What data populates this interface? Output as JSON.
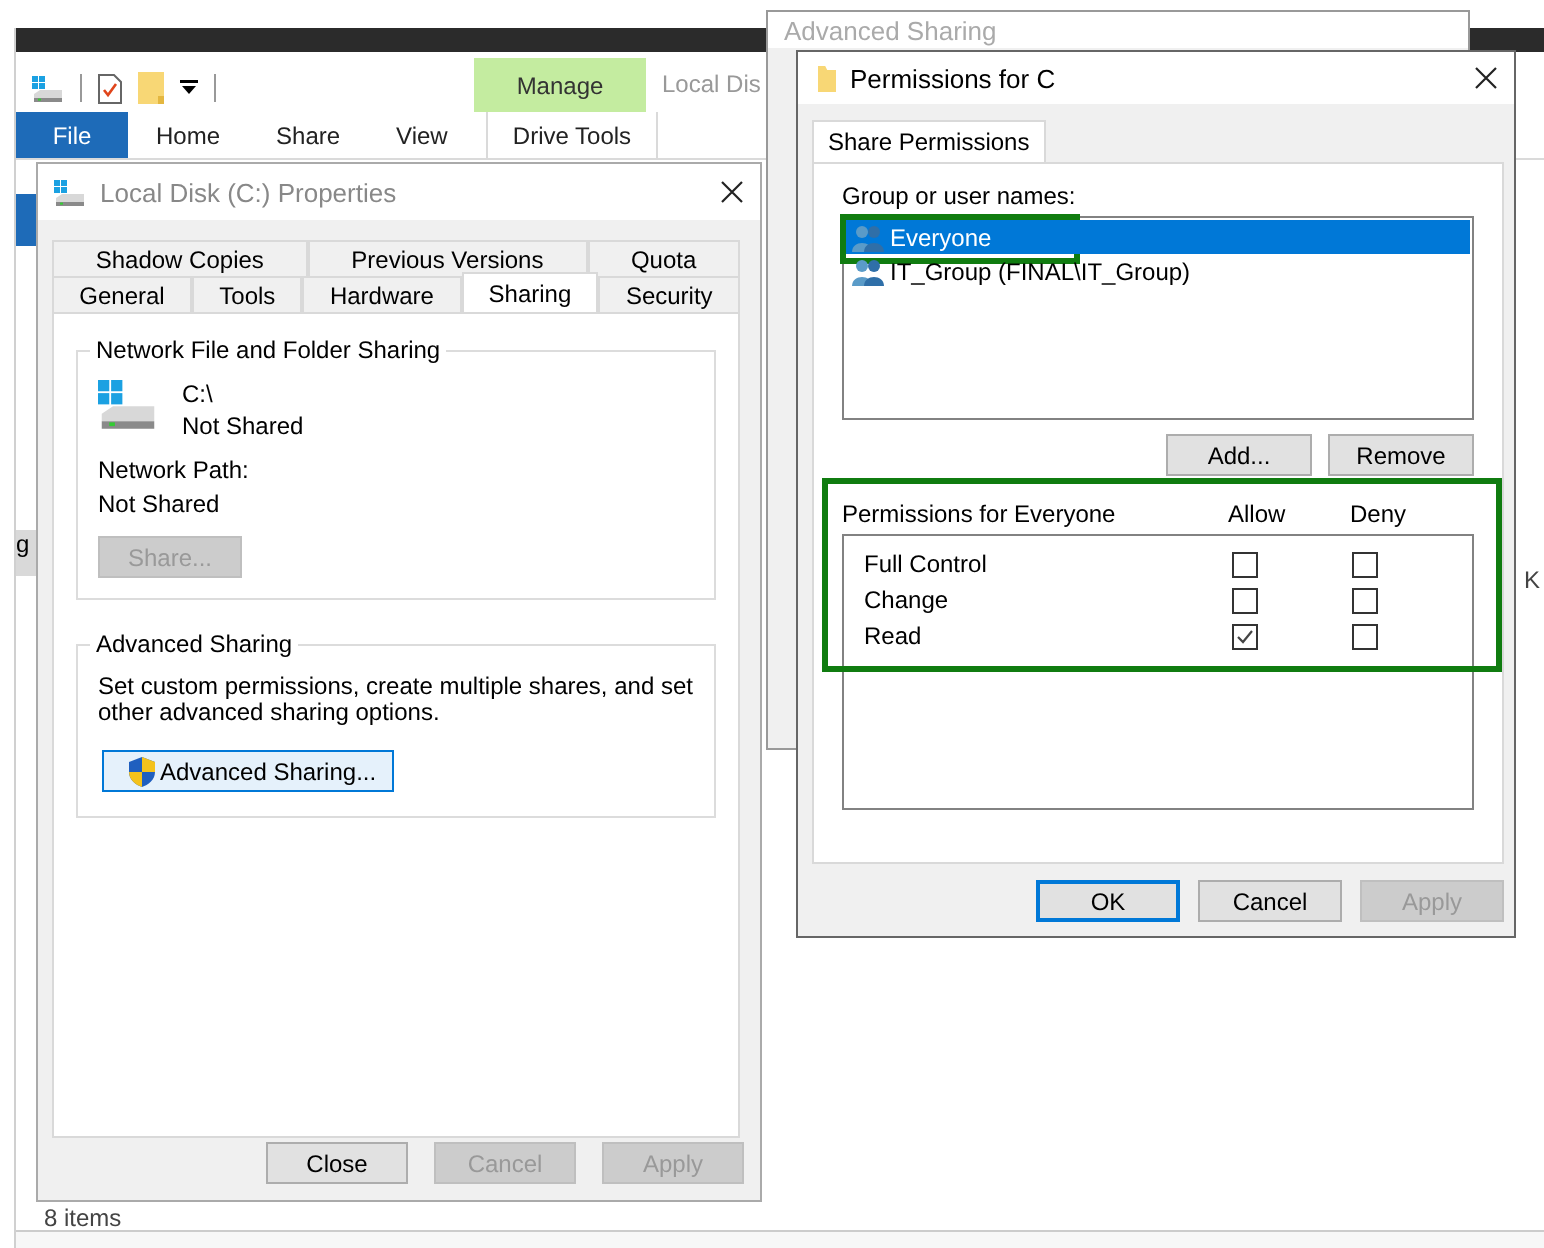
{
  "explorer": {
    "title": "Local Dis",
    "context_group": {
      "label": "Manage",
      "tab": "Drive Tools"
    },
    "ribbon_tabs": [
      {
        "label": "File",
        "kind": "file"
      },
      {
        "label": "Home",
        "kind": "tab"
      },
      {
        "label": "Share",
        "kind": "tab"
      },
      {
        "label": "View",
        "kind": "tab"
      }
    ],
    "sidebar_fragment": "g",
    "column_fragment": "K",
    "status_bar": "8 items"
  },
  "properties_dialog": {
    "title": "Local Disk (C:) Properties",
    "tab_rows": [
      [
        {
          "label": "Shadow Copies",
          "selected": false
        },
        {
          "label": "Previous Versions",
          "selected": false
        },
        {
          "label": "Quota",
          "selected": false
        }
      ],
      [
        {
          "label": "General",
          "selected": false
        },
        {
          "label": "Tools",
          "selected": false
        },
        {
          "label": "Hardware",
          "selected": false
        },
        {
          "label": "Sharing",
          "selected": true
        },
        {
          "label": "Security",
          "selected": false
        }
      ]
    ],
    "network_sharing": {
      "heading": "Network File and Folder Sharing",
      "path": "C:\\",
      "status": "Not Shared",
      "network_path_label": "Network Path:",
      "network_path": "Not Shared",
      "share_button": {
        "label": "Share...",
        "disabled": true
      }
    },
    "advanced_sharing": {
      "heading": "Advanced Sharing",
      "description": "Set custom permissions, create multiple shares, and set other advanced sharing options.",
      "button": {
        "label": "Advanced Sharing...",
        "focused": true
      }
    },
    "buttons": [
      {
        "label": "Close",
        "disabled": false
      },
      {
        "label": "Cancel",
        "disabled": true
      },
      {
        "label": "Apply",
        "disabled": true
      }
    ]
  },
  "advanced_sharing_dialog": {
    "title": "Advanced Sharing"
  },
  "permissions_dialog": {
    "title": "Permissions for C",
    "tabs": [
      {
        "label": "Share Permissions",
        "selected": true
      }
    ],
    "users_label": "Group or user names:",
    "users": [
      {
        "name": "Everyone",
        "selected": true,
        "highlighted": true
      },
      {
        "name": "IT_Group (FINAL\\IT_Group)",
        "selected": false,
        "highlighted": false
      }
    ],
    "user_buttons": [
      {
        "label": "Add...",
        "disabled": false
      },
      {
        "label": "Remove",
        "disabled": false
      }
    ],
    "permissions_label": "Permissions for Everyone",
    "permissions_highlighted": true,
    "columns": [
      "Allow",
      "Deny"
    ],
    "permissions": [
      {
        "name": "Full Control",
        "allow": false,
        "deny": false
      },
      {
        "name": "Change",
        "allow": false,
        "deny": false
      },
      {
        "name": "Read",
        "allow": true,
        "deny": false
      }
    ],
    "buttons": [
      {
        "label": "OK",
        "disabled": false,
        "default": true
      },
      {
        "label": "Cancel",
        "disabled": false,
        "default": false
      },
      {
        "label": "Apply",
        "disabled": true,
        "default": false
      }
    ]
  }
}
